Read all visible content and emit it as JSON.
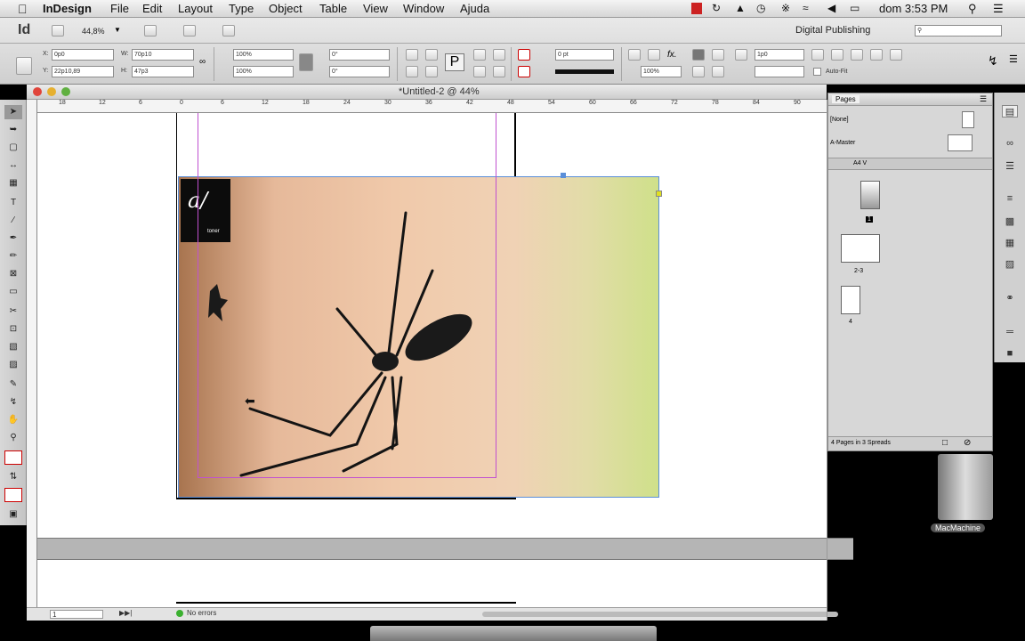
{
  "menubar": {
    "app": "InDesign",
    "items": [
      "File",
      "Edit",
      "Layout",
      "Type",
      "Object",
      "Table",
      "View",
      "Window",
      "Ajuda"
    ],
    "clock": "dom 3:53 PM"
  },
  "control": {
    "zoom": "44,8%",
    "workspace": "Digital Publishing",
    "x": "0p0",
    "y": "22p10,89",
    "w": "70p10",
    "h": "47p3",
    "scale_x": "100%",
    "scale_y": "100%",
    "angle": "0°",
    "shear": "0°",
    "stroke_weight": "0 pt",
    "opacity": "100%",
    "fit_value": "1p0",
    "autofit": "Auto-Fit"
  },
  "document": {
    "title": "*Untitled-2 @ 44%",
    "ruler_numbers": [
      "18",
      "12",
      "6",
      "0",
      "6",
      "12",
      "18",
      "24",
      "30",
      "36",
      "42",
      "48",
      "54",
      "60",
      "66",
      "72",
      "78",
      "84",
      "90"
    ],
    "logo_text": "toner"
  },
  "pages_panel": {
    "tab": "Pages",
    "none": "[None]",
    "master": "A-Master",
    "size": "A4 V",
    "page1": "1",
    "spread2": "2-3",
    "page4": "4",
    "footer": "4 Pages in 3 Spreads"
  },
  "status": {
    "page": "1",
    "errors": "No errors"
  },
  "desktop": {
    "machine": "MacMachine"
  },
  "colors": {
    "accent": "#cc2222",
    "frame": "#5b8fd9",
    "margin": "#c050d0"
  }
}
